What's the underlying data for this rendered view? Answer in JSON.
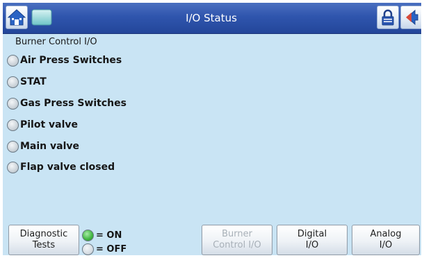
{
  "header": {
    "title": "I/O Status"
  },
  "section": {
    "label": "Burner Control I/O"
  },
  "io_items": [
    {
      "label": "Air Press Switches",
      "state": "off"
    },
    {
      "label": "STAT",
      "state": "off"
    },
    {
      "label": "Gas Press Switches",
      "state": "off"
    },
    {
      "label": "Pilot valve",
      "state": "off"
    },
    {
      "label": "Main valve",
      "state": "off"
    },
    {
      "label": "Flap valve closed",
      "state": "off"
    }
  ],
  "legend": {
    "on_label": "= ON",
    "off_label": "= OFF",
    "on_color": "#3fb53f",
    "off_color": "#d6dde3"
  },
  "footer": {
    "diagnostic_label": "Diagnostic\nTests",
    "burner_label": "Burner\nControl I/O",
    "digital_label": "Digital\nI/O",
    "analog_label": "Analog\nI/O"
  },
  "icons": {
    "home": "home-icon",
    "screen": "monitor-icon",
    "lock": "lock-icon",
    "back": "back-arrow-icon"
  }
}
